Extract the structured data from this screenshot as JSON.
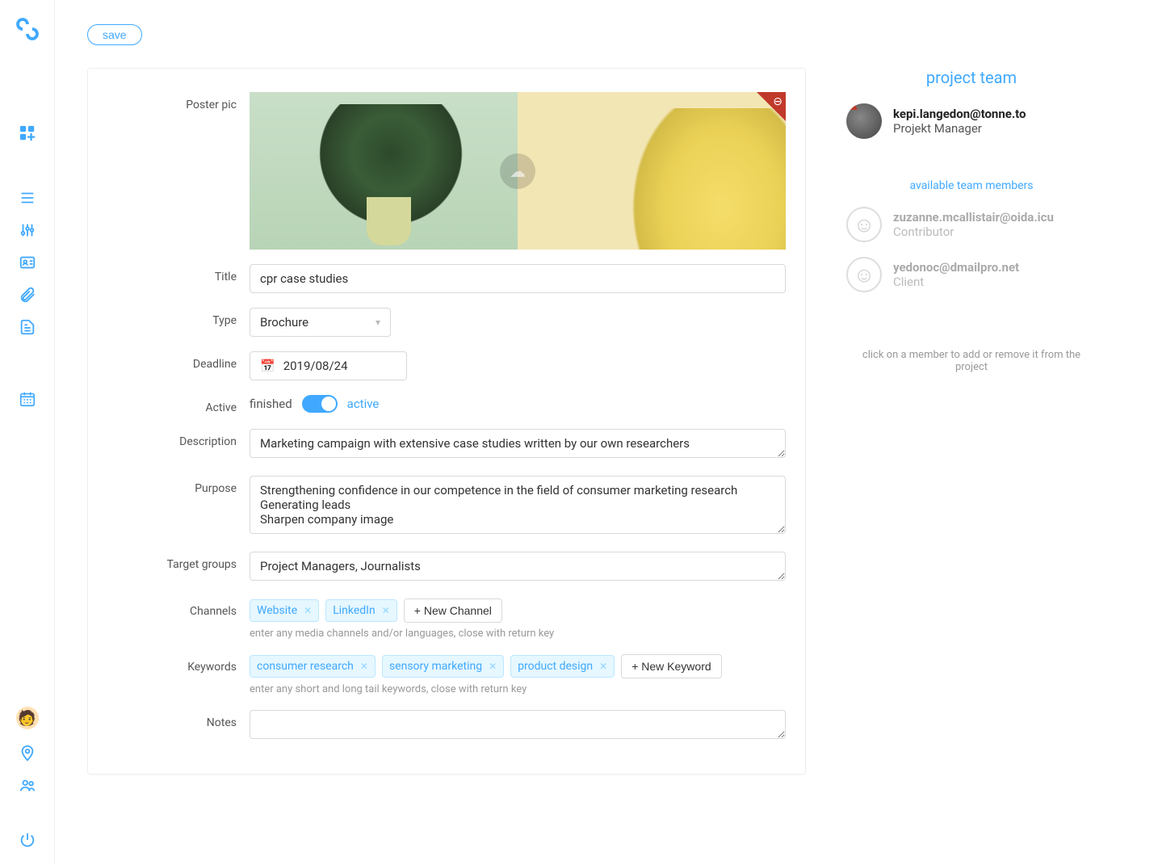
{
  "save_label": "save",
  "labels": {
    "poster": "Poster pic",
    "title": "Title",
    "type": "Type",
    "deadline": "Deadline",
    "active": "Active",
    "description": "Description",
    "purpose": "Purpose",
    "target_groups": "Target groups",
    "channels": "Channels",
    "keywords": "Keywords",
    "notes": "Notes"
  },
  "title_value": "cpr case studies",
  "type_value": "Brochure",
  "deadline_value": "2019/08/24",
  "active": {
    "finished": "finished",
    "active": "active"
  },
  "description_value": "Marketing campaign with extensive case studies written by our own researchers",
  "purpose_value": "Strengthening confidence in our competence in the field of consumer marketing research\nGenerating leads\nSharpen company image",
  "target_groups_value": "Project Managers, Journalists",
  "channels": [
    "Website",
    "LinkedIn"
  ],
  "channels_new": "+ New Channel",
  "channels_hint": "enter any media channels and/or languages, close with return key",
  "keywords": [
    "consumer research",
    "sensory marketing",
    "product design"
  ],
  "keywords_new": "+ New Keyword",
  "keywords_hint": "enter any short and long tail keywords, close with return key",
  "team": {
    "header": "project team",
    "members": [
      {
        "email": "kepi.langedon@tonne.to",
        "role": "Projekt Manager"
      }
    ],
    "available_header": "available team members",
    "available": [
      {
        "email": "zuzanne.mcallistair@oida.icu",
        "role": "Contributor"
      },
      {
        "email": "yedonoc@dmailpro.net",
        "role": "Client"
      }
    ],
    "note": "click on a member to add or remove it from the project"
  }
}
